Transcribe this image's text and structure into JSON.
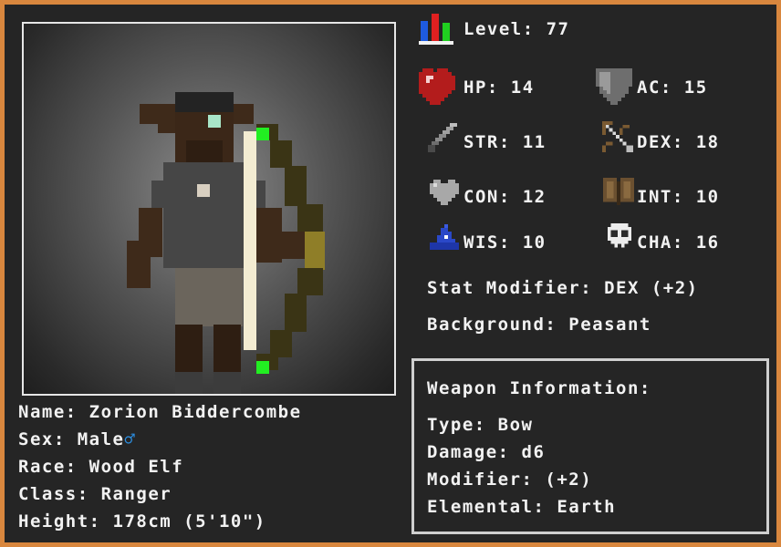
{
  "character": {
    "name_line": "Name: Zorion Biddercombe",
    "sex_line": "Sex: Male",
    "sex_symbol": "♂",
    "race_line": "Race: Wood Elf",
    "class_line": "Class: Ranger",
    "height_line": "Height: 178cm (5'10\")"
  },
  "stats": {
    "level": "Level: 77",
    "hp": "HP: 14",
    "ac": "AC: 15",
    "str": "STR: 11",
    "dex": "DEX: 18",
    "con": "CON: 12",
    "int": "INT: 10",
    "wis": "WIS: 10",
    "cha": "CHA: 16",
    "stat_modifier": "Stat Modifier: DEX (+2)",
    "background": "Background: Peasant"
  },
  "weapon": {
    "heading": "Weapon Information:",
    "type": "Type: Bow",
    "damage": "Damage: d6",
    "modifier": "Modifier: (+2)",
    "elemental": "Elemental: Earth"
  },
  "icons": {
    "level": "level-bars-icon",
    "hp": "heart-icon",
    "ac": "shield-icon",
    "str": "sword-icon",
    "dex": "bow-arrow-icon",
    "con": "grey-heart-icon",
    "int": "book-icon",
    "wis": "wizard-hat-icon",
    "cha": "skull-icon"
  },
  "colors": {
    "border": "#d9873e",
    "background": "#252525",
    "text": "#f2f2f2",
    "male_symbol": "#2c8ee0"
  }
}
